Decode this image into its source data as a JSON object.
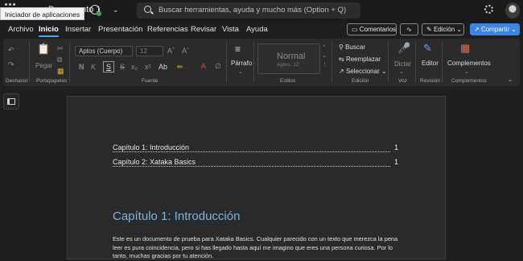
{
  "titlebar": {
    "tooltip": "Iniciador de aplicaciones",
    "doc_title": "Documento 1",
    "search_placeholder": "Buscar herramientas, ayuda y mucho más (Option + Q)"
  },
  "menu": {
    "tabs": [
      "Archivo",
      "Inicio",
      "Insertar",
      "Presentación",
      "Referencias",
      "Revisar",
      "Vista",
      "Ayuda"
    ],
    "active": "Inicio",
    "comments_label": "Comentarios",
    "edit_label": "Edición",
    "share_label": "Compartir"
  },
  "ribbon": {
    "undo_group": "Deshacer",
    "clipboard": {
      "paste_label": "Pegar",
      "group": "Portapapeles"
    },
    "font": {
      "font_name": "Aptos (Cuerpo)",
      "font_size": "12",
      "bold": "N",
      "italic": "K",
      "underline": "S",
      "strike": "S",
      "font_letters": "Ab",
      "group": "Fuente"
    },
    "paragraph_label": "Párrafo",
    "styles": {
      "style_name": "Normal",
      "style_sub": "Aptos, 12",
      "group": "Estilos"
    },
    "editing": {
      "find": "Buscar",
      "replace": "Reemplazar",
      "select": "Seleccionar",
      "group": "Edición"
    },
    "voice": {
      "dictate": "Dictar",
      "group": "Voz"
    },
    "review": {
      "editor": "Editor",
      "group": "Revisión"
    },
    "addins": {
      "label": "Complementos",
      "group": "Complementos"
    }
  },
  "document": {
    "toc": [
      {
        "label": "Capítulo 1: Introducción",
        "page": "1"
      },
      {
        "label": "Capítulo 2: Xataka Basics",
        "page": "1"
      }
    ],
    "heading": "Capítulo 1: Introducción",
    "body": "Este es un documento de prueba para Xataka Basics. Cualquier parecido con un texto que merezca la pena leer es pura coincidencia, pero si has llegado hasta aquí me imagino que eres una persona curiosa. Por lo tanto, muchas gracias por tu atención."
  },
  "colors": {
    "accent": "#3a86e0",
    "heading": "#79b4e6",
    "background": "#1f1f1f"
  },
  "icons": [
    "app-launcher-icon",
    "sync-icon",
    "search-icon",
    "settings-icon",
    "undo-icon",
    "redo-icon",
    "paste-icon",
    "highlight-icon",
    "font-color-icon",
    "find-icon",
    "replace-icon",
    "dictate-icon",
    "editor-icon",
    "addins-icon",
    "navigation-pane-icon"
  ]
}
